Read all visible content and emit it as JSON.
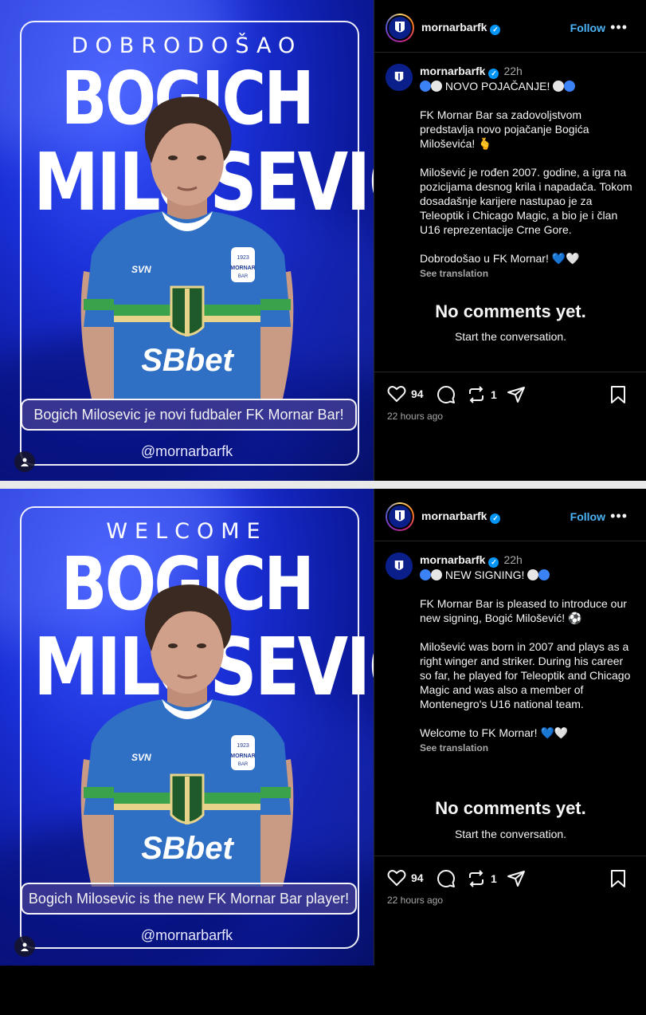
{
  "posts": [
    {
      "media": {
        "kicker": "DOBRODOŠAO",
        "first_name": "BOGICH",
        "last_name": "MILOSEVIC",
        "caption": "Bogich Milosevic je novi fudbaler FK Mornar Bar!",
        "handle_tag": "@mornarbarfk",
        "jersey_sponsor": "SBbet",
        "jersey_brand": "SVN",
        "crest_year": "1923",
        "crest_name": "MORNAR",
        "crest_city": "BAR"
      },
      "header": {
        "account": "mornarbarfk",
        "follow_label": "Follow",
        "more_label": "•••"
      },
      "caption": {
        "account": "mornarbarfk",
        "time": "22h",
        "headline": "NOVO POJAČANJE!",
        "para1": "FK Mornar Bar sa zadovoljstvom predstavlja novo pojačanje Bogića Miloševića! 🫰",
        "para2": "Milošević je rođen 2007. godine, a igra na pozicijama desnog krila i napadača. Tokom dosadašnje karijere nastupao je za Teleoptik i Chicago Magic, a bio je i član U16 reprezentacije Crne Gore.",
        "para3": "Dobrodošao u FK Mornar! 💙🤍",
        "see_translation": "See translation"
      },
      "comments": {
        "empty_title": "No comments yet.",
        "empty_sub": "Start the conversation."
      },
      "actions": {
        "likes": "94",
        "reposts": "1",
        "ago": "22 hours ago"
      }
    },
    {
      "media": {
        "kicker": "WELCOME",
        "first_name": "BOGICH",
        "last_name": "MILOSEVIC",
        "caption": "Bogich Milosevic is the new FK Mornar Bar player!",
        "handle_tag": "@mornarbarfk",
        "jersey_sponsor": "SBbet",
        "jersey_brand": "SVN",
        "crest_year": "1923",
        "crest_name": "MORNAR",
        "crest_city": "BAR"
      },
      "header": {
        "account": "mornarbarfk",
        "follow_label": "Follow",
        "more_label": "•••"
      },
      "caption": {
        "account": "mornarbarfk",
        "time": "22h",
        "headline": "NEW SIGNING!",
        "para1": "FK Mornar Bar is pleased to introduce our new signing, Bogić Milošević! ⚽",
        "para2": "Milošević was born in 2007 and plays as a right winger and striker. During his career so far, he played for Teleoptik and Chicago Magic and was also a member of Montenegro's U16 national team.",
        "para3": "Welcome to FK Mornar! 💙🤍",
        "see_translation": "See translation"
      },
      "comments": {
        "empty_title": "No comments yet.",
        "empty_sub": "Start the conversation."
      },
      "actions": {
        "likes": "94",
        "reposts": "1",
        "ago": "22 hours ago"
      }
    }
  ],
  "colors": {
    "accent_blue": "#4cb5f9",
    "verified": "#0095f6",
    "background": "#000000",
    "muted": "#a8a8a8"
  },
  "icons": [
    "heart-icon",
    "comment-icon",
    "repost-icon",
    "share-icon",
    "bookmark-icon",
    "more-icon",
    "verified-icon",
    "user-tag-icon"
  ]
}
